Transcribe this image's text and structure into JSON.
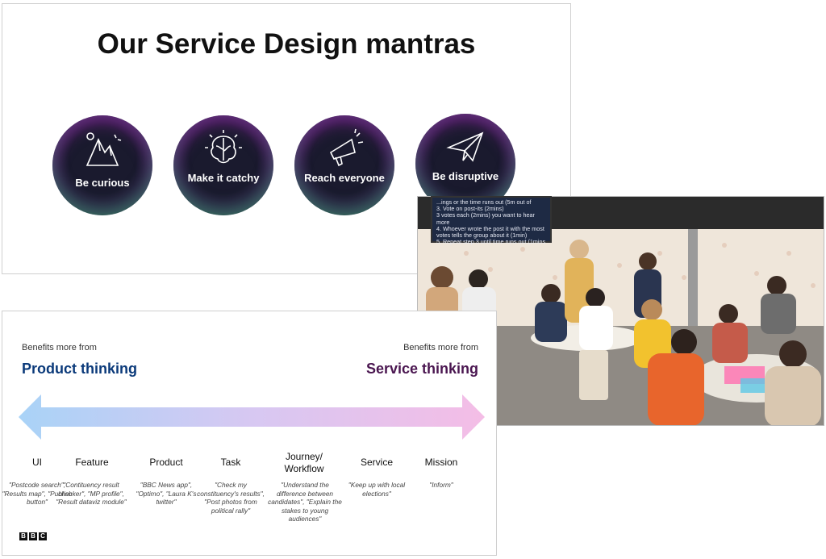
{
  "slide1": {
    "title": "Our Service Design mantras",
    "mantras": [
      {
        "label": "Be curious",
        "icon": "mountain-icon"
      },
      {
        "label": "Make it catchy",
        "icon": "brain-icon"
      },
      {
        "label": "Reach everyone",
        "icon": "megaphone-icon"
      },
      {
        "label": "Be disruptive",
        "icon": "paper-plane-icon"
      }
    ]
  },
  "photo": {
    "screen_lines": [
      "...ings or the time runs out (5m out of",
      "3. Vote on post-its (2mins)",
      "3 votes each (2mins) you want to hear more",
      "4. Whoever wrote the post it with the most",
      "votes tells the group about it (1min)",
      "5. Repeat step 3 until time runs out (1mins"
    ]
  },
  "slide2": {
    "left_label": "Benefits more from",
    "left_heading": "Product thinking",
    "right_label": "Benefits more from",
    "right_heading": "Service thinking",
    "colors": {
      "product": "#0b3a7a",
      "service": "#4a1650",
      "arrow_start": "#a9d3f7",
      "arrow_end": "#f4bde6"
    },
    "categories": [
      {
        "name": "UI",
        "examples": "\"Postcode search\", \"Results map\", \"Publish button\""
      },
      {
        "name": "Feature",
        "examples": "\"Contituency result checker\", \"MP profile\", \"Result dataviz module\""
      },
      {
        "name": "Product",
        "examples": "\"BBC News app\", \"Optimo\", \"Laura K's twitter\""
      },
      {
        "name": "Task",
        "examples": "\"Check my constituency's results\", \"Post photos from political rally\""
      },
      {
        "name": "Journey/ Workflow",
        "examples": "\"Understand the difference between candidates\", \"Explain the stakes to young audiences\""
      },
      {
        "name": "Service",
        "examples": "\"Keep up with local elections\""
      },
      {
        "name": "Mission",
        "examples": "\"Inform\""
      }
    ],
    "logo_letters": [
      "B",
      "B",
      "C"
    ]
  }
}
